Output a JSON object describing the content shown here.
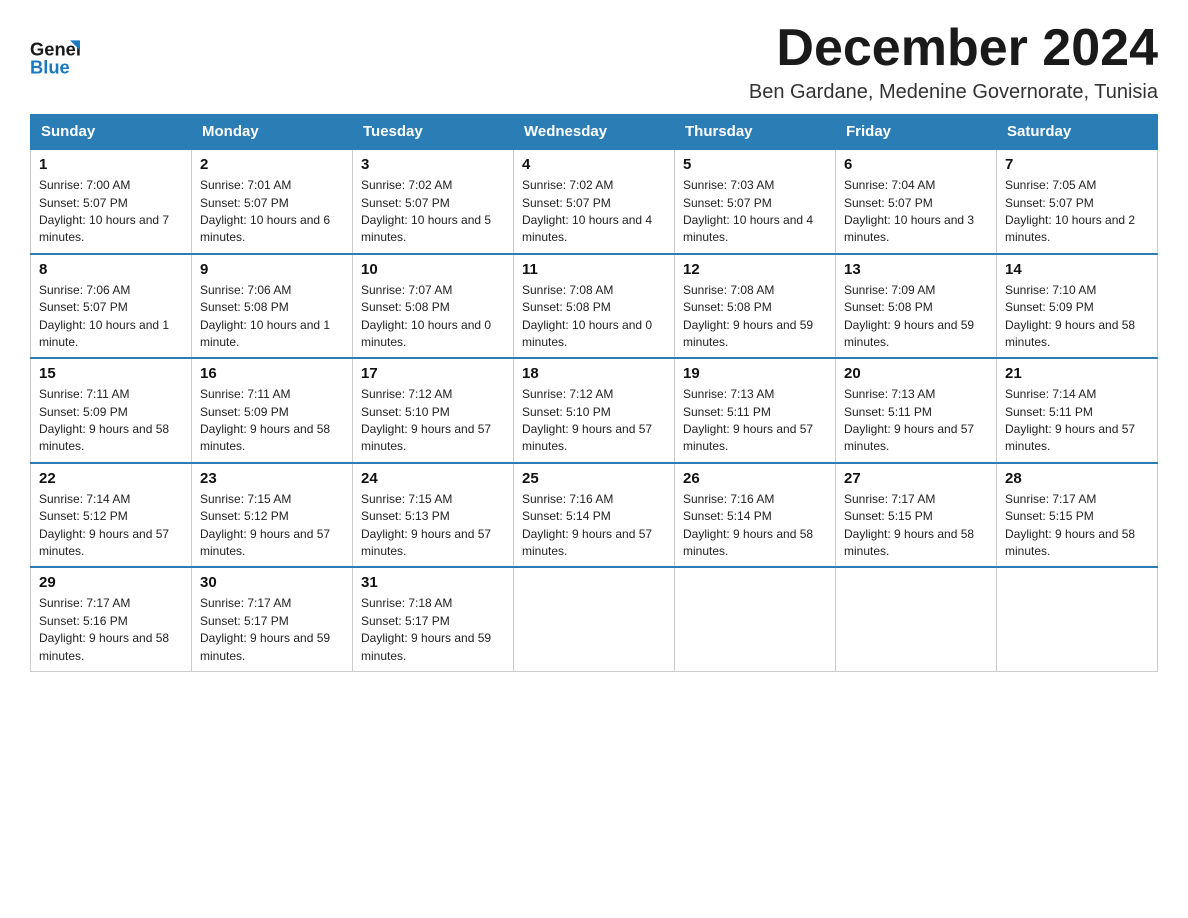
{
  "header": {
    "logo_line1": "General",
    "logo_line2": "Blue",
    "month_title": "December 2024",
    "subtitle": "Ben Gardane, Medenine Governorate, Tunisia"
  },
  "days_of_week": [
    "Sunday",
    "Monday",
    "Tuesday",
    "Wednesday",
    "Thursday",
    "Friday",
    "Saturday"
  ],
  "weeks": [
    [
      {
        "day": "1",
        "sunrise": "7:00 AM",
        "sunset": "5:07 PM",
        "daylight": "10 hours and 7 minutes."
      },
      {
        "day": "2",
        "sunrise": "7:01 AM",
        "sunset": "5:07 PM",
        "daylight": "10 hours and 6 minutes."
      },
      {
        "day": "3",
        "sunrise": "7:02 AM",
        "sunset": "5:07 PM",
        "daylight": "10 hours and 5 minutes."
      },
      {
        "day": "4",
        "sunrise": "7:02 AM",
        "sunset": "5:07 PM",
        "daylight": "10 hours and 4 minutes."
      },
      {
        "day": "5",
        "sunrise": "7:03 AM",
        "sunset": "5:07 PM",
        "daylight": "10 hours and 4 minutes."
      },
      {
        "day": "6",
        "sunrise": "7:04 AM",
        "sunset": "5:07 PM",
        "daylight": "10 hours and 3 minutes."
      },
      {
        "day": "7",
        "sunrise": "7:05 AM",
        "sunset": "5:07 PM",
        "daylight": "10 hours and 2 minutes."
      }
    ],
    [
      {
        "day": "8",
        "sunrise": "7:06 AM",
        "sunset": "5:07 PM",
        "daylight": "10 hours and 1 minute."
      },
      {
        "day": "9",
        "sunrise": "7:06 AM",
        "sunset": "5:08 PM",
        "daylight": "10 hours and 1 minute."
      },
      {
        "day": "10",
        "sunrise": "7:07 AM",
        "sunset": "5:08 PM",
        "daylight": "10 hours and 0 minutes."
      },
      {
        "day": "11",
        "sunrise": "7:08 AM",
        "sunset": "5:08 PM",
        "daylight": "10 hours and 0 minutes."
      },
      {
        "day": "12",
        "sunrise": "7:08 AM",
        "sunset": "5:08 PM",
        "daylight": "9 hours and 59 minutes."
      },
      {
        "day": "13",
        "sunrise": "7:09 AM",
        "sunset": "5:08 PM",
        "daylight": "9 hours and 59 minutes."
      },
      {
        "day": "14",
        "sunrise": "7:10 AM",
        "sunset": "5:09 PM",
        "daylight": "9 hours and 58 minutes."
      }
    ],
    [
      {
        "day": "15",
        "sunrise": "7:11 AM",
        "sunset": "5:09 PM",
        "daylight": "9 hours and 58 minutes."
      },
      {
        "day": "16",
        "sunrise": "7:11 AM",
        "sunset": "5:09 PM",
        "daylight": "9 hours and 58 minutes."
      },
      {
        "day": "17",
        "sunrise": "7:12 AM",
        "sunset": "5:10 PM",
        "daylight": "9 hours and 57 minutes."
      },
      {
        "day": "18",
        "sunrise": "7:12 AM",
        "sunset": "5:10 PM",
        "daylight": "9 hours and 57 minutes."
      },
      {
        "day": "19",
        "sunrise": "7:13 AM",
        "sunset": "5:11 PM",
        "daylight": "9 hours and 57 minutes."
      },
      {
        "day": "20",
        "sunrise": "7:13 AM",
        "sunset": "5:11 PM",
        "daylight": "9 hours and 57 minutes."
      },
      {
        "day": "21",
        "sunrise": "7:14 AM",
        "sunset": "5:11 PM",
        "daylight": "9 hours and 57 minutes."
      }
    ],
    [
      {
        "day": "22",
        "sunrise": "7:14 AM",
        "sunset": "5:12 PM",
        "daylight": "9 hours and 57 minutes."
      },
      {
        "day": "23",
        "sunrise": "7:15 AM",
        "sunset": "5:12 PM",
        "daylight": "9 hours and 57 minutes."
      },
      {
        "day": "24",
        "sunrise": "7:15 AM",
        "sunset": "5:13 PM",
        "daylight": "9 hours and 57 minutes."
      },
      {
        "day": "25",
        "sunrise": "7:16 AM",
        "sunset": "5:14 PM",
        "daylight": "9 hours and 57 minutes."
      },
      {
        "day": "26",
        "sunrise": "7:16 AM",
        "sunset": "5:14 PM",
        "daylight": "9 hours and 58 minutes."
      },
      {
        "day": "27",
        "sunrise": "7:17 AM",
        "sunset": "5:15 PM",
        "daylight": "9 hours and 58 minutes."
      },
      {
        "day": "28",
        "sunrise": "7:17 AM",
        "sunset": "5:15 PM",
        "daylight": "9 hours and 58 minutes."
      }
    ],
    [
      {
        "day": "29",
        "sunrise": "7:17 AM",
        "sunset": "5:16 PM",
        "daylight": "9 hours and 58 minutes."
      },
      {
        "day": "30",
        "sunrise": "7:17 AM",
        "sunset": "5:17 PM",
        "daylight": "9 hours and 59 minutes."
      },
      {
        "day": "31",
        "sunrise": "7:18 AM",
        "sunset": "5:17 PM",
        "daylight": "9 hours and 59 minutes."
      },
      null,
      null,
      null,
      null
    ]
  ]
}
